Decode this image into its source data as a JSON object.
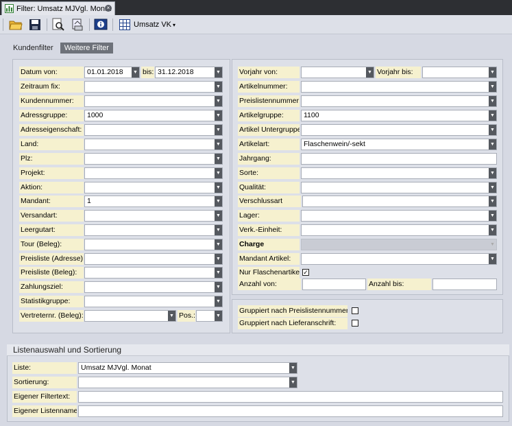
{
  "window": {
    "tab_title": "Filter: Umsatz MJVgl. Monat"
  },
  "toolbar": {
    "icons": [
      "open-folder-icon",
      "save-icon",
      "search-preview-icon",
      "export-icon",
      "info-icon",
      "table-icon"
    ],
    "combo_label": "Umsatz VK"
  },
  "subtabs": {
    "kundenfilter": "Kundenfilter",
    "weitere": "Weitere Filter"
  },
  "left": {
    "datum_von": {
      "label": "Datum von:",
      "value": "01.01.2018"
    },
    "bis": {
      "label": "bis:",
      "value": "31.12.2018"
    },
    "zeitraum_fix": {
      "label": "Zeitraum fix:",
      "value": ""
    },
    "kundennummer": {
      "label": "Kundennummer:",
      "value": ""
    },
    "adressgruppe": {
      "label": "Adressgruppe:",
      "value": "1000"
    },
    "adresseigenschaft": {
      "label": "Adresseigenschaft:",
      "value": ""
    },
    "land": {
      "label": "Land:",
      "value": ""
    },
    "plz": {
      "label": "Plz:",
      "value": ""
    },
    "projekt": {
      "label": "Projekt:",
      "value": ""
    },
    "aktion": {
      "label": "Aktion:",
      "value": ""
    },
    "mandant": {
      "label": "Mandant:",
      "value": "1"
    },
    "versandart": {
      "label": "Versandart:",
      "value": ""
    },
    "leergutart": {
      "label": "Leergutart:",
      "value": ""
    },
    "tour": {
      "label": "Tour (Beleg):",
      "value": ""
    },
    "preisliste_adresse": {
      "label": "Preisliste (Adresse):",
      "value": ""
    },
    "preisliste_beleg": {
      "label": "Preisliste (Beleg):",
      "value": ""
    },
    "zahlungsziel": {
      "label": "Zahlungsziel:",
      "value": ""
    },
    "statistikgruppe": {
      "label": "Statistikgruppe:",
      "value": ""
    },
    "vertreternr": {
      "label": "Vertreternr. (Beleg):",
      "value": ""
    },
    "pos": {
      "label": "Pos.:",
      "value": ""
    }
  },
  "right": {
    "vorjahr_von": {
      "label": "Vorjahr von:",
      "value": ""
    },
    "vorjahr_bis": {
      "label": "Vorjahr bis:",
      "value": ""
    },
    "artikelnummer": {
      "label": "Artikelnummer:",
      "value": ""
    },
    "preislistennummer": {
      "label": "Preislistennummer:",
      "value": ""
    },
    "artikelgruppe": {
      "label": "Artikelgruppe:",
      "value": "1100"
    },
    "artikel_untergruppe": {
      "label": "Artikel Untergruppe:",
      "value": ""
    },
    "artikelart": {
      "label": "Artikelart:",
      "value": "Flaschenwein/-sekt"
    },
    "jahrgang": {
      "label": "Jahrgang:",
      "value": ""
    },
    "sorte": {
      "label": "Sorte:",
      "value": ""
    },
    "qualitaet": {
      "label": "Qualität:",
      "value": ""
    },
    "verschlussart": {
      "label": "Verschlussart",
      "value": ""
    },
    "lager": {
      "label": "Lager:",
      "value": ""
    },
    "verk_einheit": {
      "label": "Verk.-Einheit:",
      "value": ""
    },
    "charge": {
      "label": "Charge",
      "value": ""
    },
    "mandant_artikel": {
      "label": "Mandant Artikel:",
      "value": ""
    },
    "nur_flaschenartikel": {
      "label": "Nur Flaschenartikel:",
      "checked": true,
      "mark": "✓"
    },
    "anzahl_von": {
      "label": "Anzahl von:",
      "value": ""
    },
    "anzahl_bis": {
      "label": "Anzahl bis:",
      "value": ""
    },
    "grp_preisliste": {
      "label": "Gruppiert nach Preislistennummer:",
      "checked": false
    },
    "grp_liefer": {
      "label": "Gruppiert nach Lieferanschrift:",
      "checked": false
    }
  },
  "listen": {
    "heading": "Listenauswahl und Sortierung",
    "liste": {
      "label": "Liste:",
      "value": "Umsatz MJVgl. Monat"
    },
    "sortierung": {
      "label": "Sortierung:",
      "value": ""
    },
    "filtertext": {
      "label": "Eigener Filtertext:",
      "value": ""
    },
    "listenname": {
      "label": "Eigener Listenname:",
      "value": ""
    }
  },
  "colors": {
    "label_bg": "#f6f1cf",
    "panel_bg": "#dde0e8",
    "dropdown_btn": "#55595f",
    "topbar": "#2d2f33"
  }
}
